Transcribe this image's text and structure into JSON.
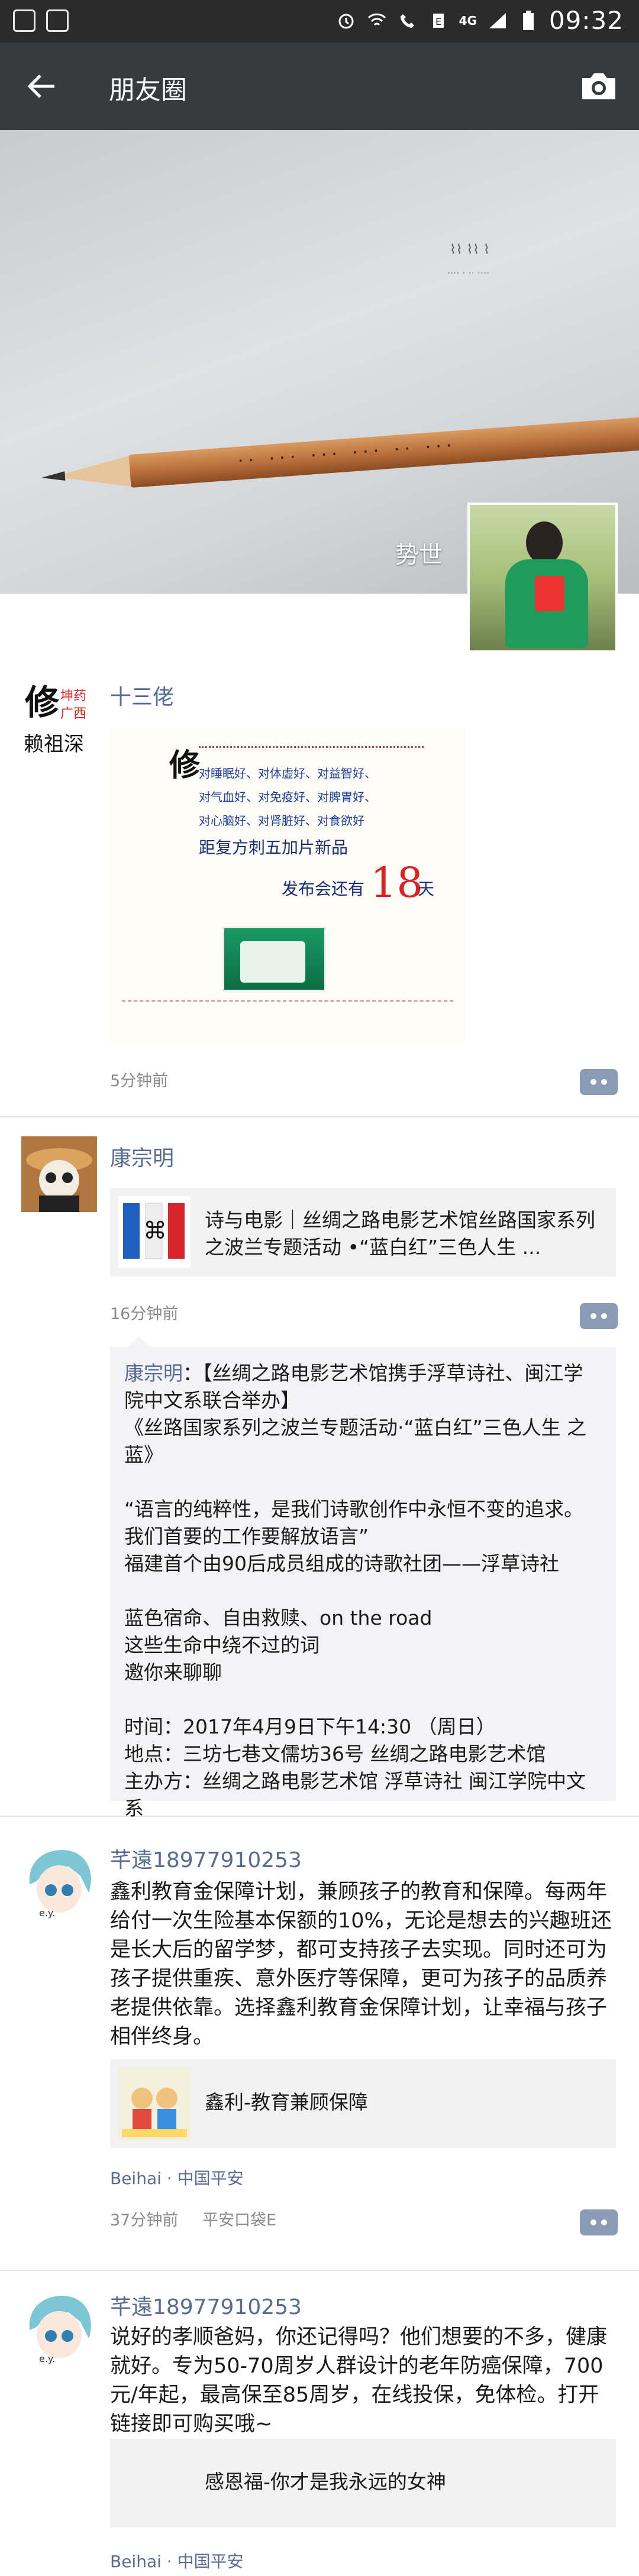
{
  "status_bar": {
    "time": "09:32",
    "network": "4G",
    "icons": [
      "square-app-icon",
      "square-app-icon",
      "alarm-icon",
      "wifi-call-icon",
      "phone-icon",
      "mail-icon",
      "4g-icon",
      "signal-icon",
      "battery-icon"
    ]
  },
  "header": {
    "title": "朋友圈",
    "back_icon": "arrow-left-icon",
    "camera_icon": "camera-icon"
  },
  "cover": {
    "user_name": "势世"
  },
  "posts": [
    {
      "author": "十三佬",
      "time": "5分钟前",
      "poster": {
        "logo": "修",
        "line1": "对睡眠好、对体虚好、对益智好、",
        "line2": "对气血好、对免疫好、对脾胃好、",
        "line3": "对心脑好、对肾脏好、对食欲好",
        "line4": "距复方刺五加片新品",
        "line5": "发布会还有",
        "count": "18",
        "unit": "天",
        "avatar_text": [
          "坤药",
          "广西",
          "赖祖深"
        ]
      }
    },
    {
      "author": "康宗明",
      "link_title": "诗与电影｜丝绸之路电影艺术馆丝路国家系列之波兰专题活动 •“蓝白红”三色人生 ...",
      "time": "16分钟前",
      "comment_author": "康宗明",
      "comment_body": "【丝绸之路电影艺术馆携手浮草诗社、闽江学院中文系联合举办】\n《丝路国家系列之波兰专题活动·“蓝白红”三色人生 之蓝》\n\n“语言的纯粹性，是我们诗歌创作中永恒不变的追求。我们首要的工作要解放语言”\n福建首个由90后成员组成的诗歌社团——浮草诗社\n\n蓝色宿命、自由救赎、on the road\n这些生命中绕不过的词\n邀你来聊聊\n\n时间：2017年4月9日下午14:30 （周日）\n地点：三坊七巷文儒坊36号 丝绸之路电影艺术馆\n主办方：丝绸之路电影艺术馆 浮草诗社 闽江学院中文系"
    },
    {
      "author": "芊遠18977910253",
      "text": "鑫利教育金保障计划，兼顾孩子的教育和保障。每两年给付一次生险基本保额的10%，无论是想去的兴趣班还是长大后的留学梦，都可支持孩子去实现。同时还可为孩子提供重疾、意外医疗等保障，更可为孩子的品质养老提供依靠。选择鑫利教育金保障计划，让幸福与孩子相伴终身。",
      "link_title": "鑫利-教育兼顾保障",
      "location": "Beihai · 中国平安",
      "time": "37分钟前",
      "app": "平安口袋E"
    },
    {
      "author": "芊遠18977910253",
      "text": "说好的孝顺爸妈，你还记得吗？他们想要的不多，健康就好。专为50-70周岁人群设计的老年防癌保障，700元/年起，最高保至85周岁，在线投保，免体检。打开链接即可购买哦~",
      "link_title": "感恩福-你才是我永远的女神",
      "location": "Beihai · 中国平安"
    }
  ],
  "colors": {
    "header_bg": "#373b3e",
    "link_name": "#576b95",
    "time_gray": "#8a8a8a"
  }
}
